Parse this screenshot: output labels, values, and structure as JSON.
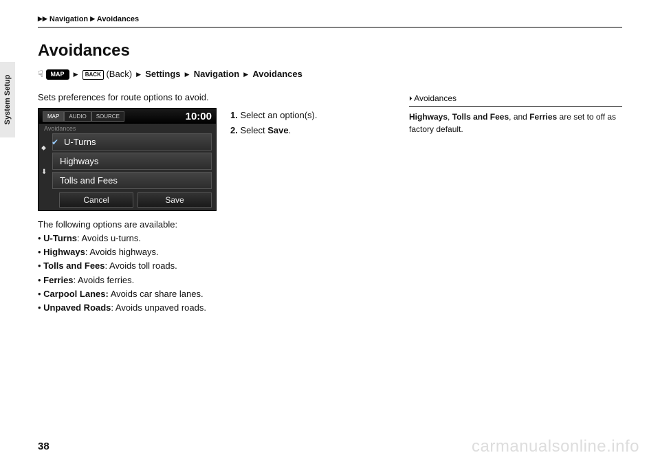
{
  "side_tab": "System Setup",
  "header": {
    "crumb1": "Navigation",
    "crumb2": "Avoidances"
  },
  "title": "Avoidances",
  "nav_path": {
    "map_pill": "MAP",
    "back_pill": "BACK",
    "back_word": "(Back)",
    "p1": "Settings",
    "p2": "Navigation",
    "p3": "Avoidances"
  },
  "intro": "Sets preferences for route options to avoid.",
  "screen": {
    "tab_map": "MAP",
    "tab_audio": "AUDIO",
    "tab_source": "SOURCE",
    "clock": "10:00",
    "label": "Avoidances",
    "row1": "U-Turns",
    "row2": "Highways",
    "row3": "Tolls and Fees",
    "btn_cancel": "Cancel",
    "btn_save": "Save"
  },
  "steps": {
    "s1n": "1.",
    "s1": "Select an option(s).",
    "s2n": "2.",
    "s2a": "Select ",
    "s2b": "Save",
    "s2c": "."
  },
  "below": {
    "lead": "The following options are available:",
    "i1a": "U-Turns",
    "i1b": ": Avoids u-turns.",
    "i2a": "Highways",
    "i2b": ": Avoids highways.",
    "i3a": "Tolls and Fees",
    "i3b": ": Avoids toll roads.",
    "i4a": "Ferries",
    "i4b": ": Avoids ferries.",
    "i5a": "Carpool Lanes:",
    "i5b": " Avoids car share lanes.",
    "i6a": "Unpaved Roads",
    "i6b": ": Avoids unpaved roads."
  },
  "note": {
    "head": "Avoidances",
    "b1": "Highways",
    "c1": ", ",
    "b2": "Tolls and Fees",
    "c2": ", and ",
    "b3": "Ferries",
    "rest": " are set to off as factory default."
  },
  "page_num": "38",
  "watermark": "carmanualsonline.info"
}
